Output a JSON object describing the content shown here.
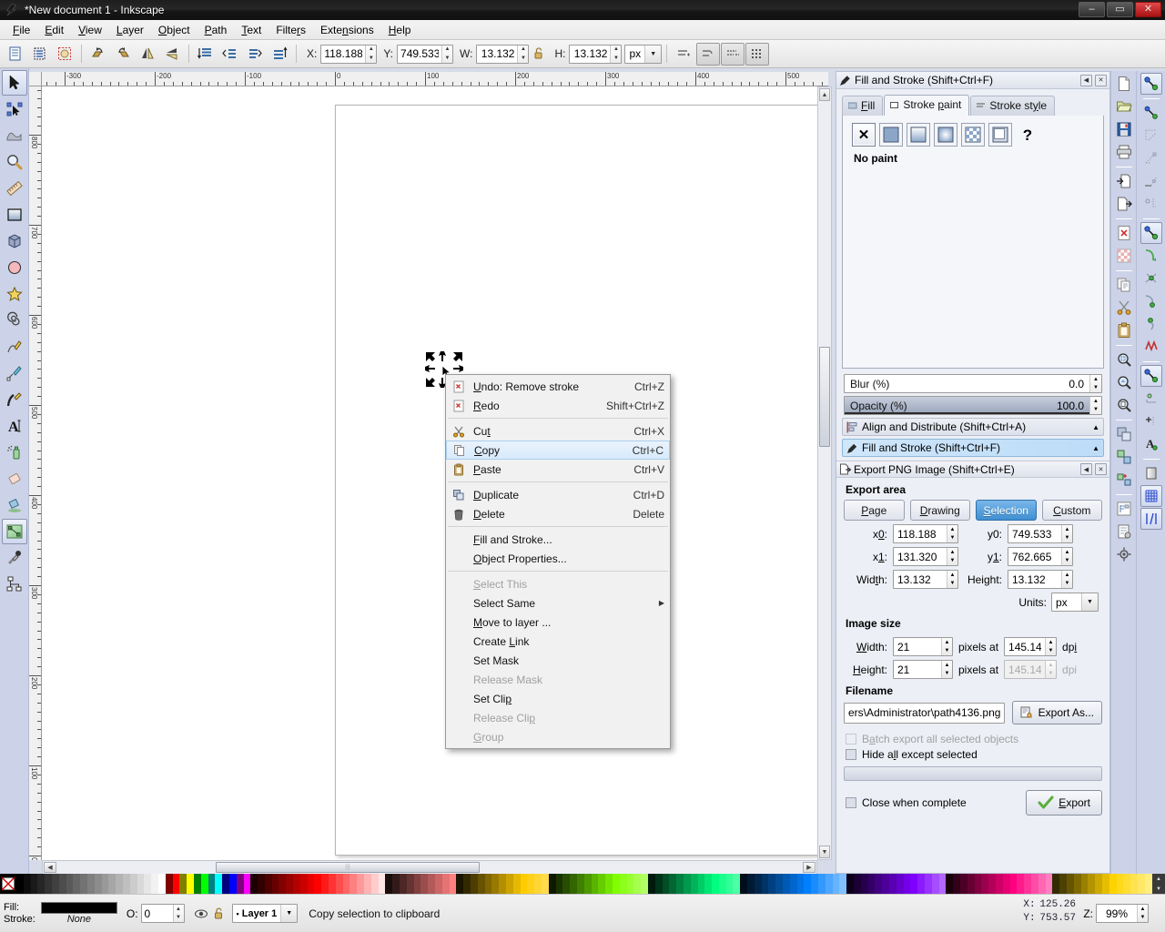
{
  "window": {
    "title": "*New document 1 - Inkscape",
    "minimize": "–",
    "maximize": "▭",
    "close": "✕"
  },
  "menubar": [
    {
      "label": "File",
      "mnemonic": "F"
    },
    {
      "label": "Edit",
      "mnemonic": "E"
    },
    {
      "label": "View",
      "mnemonic": "V"
    },
    {
      "label": "Layer",
      "mnemonic": "L"
    },
    {
      "label": "Object",
      "mnemonic": "O"
    },
    {
      "label": "Path",
      "mnemonic": "P"
    },
    {
      "label": "Text",
      "mnemonic": "T"
    },
    {
      "label": "Filters",
      "mnemonic": "r"
    },
    {
      "label": "Extensions",
      "mnemonic": "n"
    },
    {
      "label": "Help",
      "mnemonic": "H"
    }
  ],
  "toolbar": {
    "x_label": "X:",
    "x_value": "118.188",
    "y_label": "Y:",
    "y_value": "749.533",
    "w_label": "W:",
    "w_value": "13.132",
    "h_label": "H:",
    "h_value": "13.132",
    "units_value": "px",
    "lock_icon": "lock-open-icon",
    "icons": [
      "select-all-icon",
      "select-all-layers-icon",
      "deselect-icon",
      "rotate-90-ccw-icon",
      "rotate-90-cw-icon",
      "flip-horizontal-icon",
      "flip-vertical-icon",
      "raise-to-top-icon",
      "raise-icon",
      "lower-icon",
      "lower-to-bottom-icon"
    ],
    "transform_icons": [
      "affect-stroke-width-icon",
      "affect-rounded-corners-icon",
      "affect-gradients-icon",
      "affect-patterns-icon"
    ]
  },
  "toolbox": [
    {
      "name": "selector-tool",
      "selected": true
    },
    {
      "name": "node-tool",
      "selected": false
    },
    {
      "name": "tweak-tool",
      "selected": false
    },
    {
      "name": "zoom-tool",
      "selected": false
    },
    {
      "name": "measure-tool",
      "selected": false
    },
    {
      "name": "rectangle-tool",
      "selected": false
    },
    {
      "name": "3dbox-tool",
      "selected": false
    },
    {
      "name": "ellipse-tool",
      "selected": false
    },
    {
      "name": "star-tool",
      "selected": false
    },
    {
      "name": "spiral-tool",
      "selected": false
    },
    {
      "name": "pencil-tool",
      "selected": false
    },
    {
      "name": "bezier-tool",
      "selected": false
    },
    {
      "name": "calligraphy-tool",
      "selected": false
    },
    {
      "name": "text-tool",
      "selected": false
    },
    {
      "name": "spray-tool",
      "selected": false
    },
    {
      "name": "eraser-tool",
      "selected": false
    },
    {
      "name": "paintbucket-tool",
      "selected": false
    },
    {
      "name": "gradient-tool",
      "selected": true
    },
    {
      "name": "dropper-tool",
      "selected": false
    },
    {
      "name": "connector-tool",
      "selected": false
    }
  ],
  "rulers": {
    "horizontal_labels": [
      "-300",
      "-200",
      "-100",
      "0",
      "100",
      "200",
      "300",
      "400",
      "500"
    ],
    "vertical_labels": [
      "700",
      "600",
      "500",
      "400",
      "300",
      "200",
      "100",
      "0"
    ]
  },
  "context_menu": {
    "items": [
      {
        "label": "Undo: Remove stroke",
        "accel": "Ctrl+Z",
        "icon": "undo-icon",
        "state": "normal"
      },
      {
        "label": "Redo",
        "accel": "Shift+Ctrl+Z",
        "icon": "redo-icon",
        "state": "normal"
      },
      {
        "separator": true
      },
      {
        "label": "Cut",
        "accel": "Ctrl+X",
        "icon": "scissors-icon",
        "state": "normal"
      },
      {
        "label": "Copy",
        "accel": "Ctrl+C",
        "icon": "copy-icon",
        "state": "highlighted"
      },
      {
        "label": "Paste",
        "accel": "Ctrl+V",
        "icon": "clipboard-icon",
        "state": "normal"
      },
      {
        "separator": true
      },
      {
        "label": "Duplicate",
        "accel": "Ctrl+D",
        "icon": "duplicate-icon",
        "state": "normal"
      },
      {
        "label": "Delete",
        "accel": "Delete",
        "icon": "trash-icon",
        "state": "normal"
      },
      {
        "separator": true
      },
      {
        "label": "Fill and Stroke...",
        "accel": "",
        "icon": "",
        "state": "normal"
      },
      {
        "label": "Object Properties...",
        "accel": "",
        "icon": "",
        "state": "normal"
      },
      {
        "separator": true
      },
      {
        "label": "Select This",
        "accel": "",
        "icon": "",
        "state": "disabled"
      },
      {
        "label": "Select Same",
        "accel": "",
        "icon": "",
        "state": "submenu"
      },
      {
        "label": "Move to layer ...",
        "accel": "",
        "icon": "",
        "state": "normal"
      },
      {
        "label": "Create Link",
        "accel": "",
        "icon": "",
        "state": "normal"
      },
      {
        "label": "Set Mask",
        "accel": "",
        "icon": "",
        "state": "normal"
      },
      {
        "label": "Release Mask",
        "accel": "",
        "icon": "",
        "state": "disabled"
      },
      {
        "label": "Set Clip",
        "accel": "",
        "icon": "",
        "state": "normal"
      },
      {
        "label": "Release Clip",
        "accel": "",
        "icon": "",
        "state": "disabled"
      },
      {
        "label": "Group",
        "accel": "",
        "icon": "",
        "state": "disabled"
      }
    ]
  },
  "fill_stroke_panel": {
    "title": "Fill and Stroke (Shift+Ctrl+F)",
    "tabs": [
      {
        "label": "Fill",
        "active": false,
        "icon": "fill-swatch-icon"
      },
      {
        "label": "Stroke paint",
        "active": true,
        "icon": "stroke-swatch-icon"
      },
      {
        "label": "Stroke style",
        "active": false,
        "icon": "stroke-style-icon"
      }
    ],
    "paint_buttons": [
      {
        "name": "no-paint-button",
        "label": "✕",
        "active": true
      },
      {
        "name": "flat-color-button",
        "label": "",
        "active": false
      },
      {
        "name": "linear-gradient-button",
        "label": "",
        "active": false
      },
      {
        "name": "radial-gradient-button",
        "label": "",
        "active": false
      },
      {
        "name": "pattern-button",
        "label": "",
        "active": false
      },
      {
        "name": "swatch-button",
        "label": "",
        "active": false
      },
      {
        "name": "unknown-paint-button",
        "label": "?",
        "active": false
      }
    ],
    "paint_status": "No paint",
    "blur_label": "Blur (%)",
    "blur_value": "0.0",
    "opacity_label": "Opacity (%)",
    "opacity_value": "100.0"
  },
  "dock_bars": [
    {
      "label": "Align and Distribute (Shift+Ctrl+A)",
      "icon": "align-icon",
      "highlighted": false
    },
    {
      "label": "Fill and Stroke (Shift+Ctrl+F)",
      "icon": "fill-stroke-icon",
      "highlighted": true
    }
  ],
  "export_panel": {
    "title": "Export PNG Image (Shift+Ctrl+E)",
    "export_area_heading": "Export area",
    "area_buttons": [
      {
        "label": "Page",
        "mnemonic": "P",
        "selected": false
      },
      {
        "label": "Drawing",
        "mnemonic": "D",
        "selected": false
      },
      {
        "label": "Selection",
        "mnemonic": "S",
        "selected": true
      },
      {
        "label": "Custom",
        "mnemonic": "C",
        "selected": false
      }
    ],
    "fields": {
      "x0_label": "x0:",
      "x0_value": "118.188",
      "y0_label": "y0:",
      "y0_value": "749.533",
      "x1_label": "x1:",
      "x1_value": "131.320",
      "y1_label": "y1:",
      "y1_value": "762.665",
      "width_label": "Width:",
      "width_value": "13.132",
      "height_label": "Height:",
      "height_value": "13.132",
      "units_label": "Units:",
      "units_value": "px"
    },
    "image_size_heading": "Image size",
    "image_size": {
      "width_label": "Width:",
      "width_value": "21",
      "pixels_at_1": "pixels at",
      "dpi_1_value": "145.14",
      "dpi_1_label": "dpi",
      "height_label": "Height:",
      "height_value": "21",
      "pixels_at_2": "pixels at",
      "dpi_2_value": "145.14",
      "dpi_2_label": "dpi"
    },
    "filename_heading": "Filename",
    "filename_value": "ers\\Administrator\\path4136.png",
    "export_as_label": "Export As...",
    "batch_label": "Batch export all selected objects",
    "hide_label": "Hide all except selected",
    "close_label": "Close when complete",
    "export_button": "Export"
  },
  "statusbar": {
    "fill_label": "Fill:",
    "stroke_label": "Stroke:",
    "fill_color": "#000000",
    "stroke_value": "None",
    "opacity_label": "O:",
    "opacity_value": "0",
    "layer_name": "Layer 1",
    "message": "Copy selection to clipboard",
    "x_label": "X:",
    "x_value": "125.26",
    "y_label": "Y:",
    "y_value": "753.57",
    "z_label": "Z:",
    "zoom_value": "99%"
  },
  "palette": {
    "none_swatch": "none-color-swatch",
    "colors": [
      "#000000",
      "#0d0d0d",
      "#1a1a1a",
      "#262626",
      "#333333",
      "#404040",
      "#4d4d4d",
      "#595959",
      "#666666",
      "#737373",
      "#808080",
      "#8c8c8c",
      "#999999",
      "#a6a6a6",
      "#b3b3b3",
      "#bfbfbf",
      "#cccccc",
      "#d9d9d9",
      "#e6e6e6",
      "#f2f2f2",
      "#ffffff",
      "#800000",
      "#ff0000",
      "#808000",
      "#ffff00",
      "#008000",
      "#00ff00",
      "#008080",
      "#00ffff",
      "#000080",
      "#0000ff",
      "#800080",
      "#ff00ff",
      "#1a0000",
      "#330000",
      "#4d0000",
      "#660000",
      "#800000",
      "#990000",
      "#b30000",
      "#cc0000",
      "#e60000",
      "#ff0000",
      "#ff1a1a",
      "#ff3333",
      "#ff4d4d",
      "#ff6666",
      "#ff8080",
      "#ff9999",
      "#ffb3b3",
      "#ffcccc",
      "#ffe6e6",
      "#1a0d0d",
      "#331a1a",
      "#4d2626",
      "#663333",
      "#804040",
      "#994d4d",
      "#b35959",
      "#cc6666",
      "#e67373",
      "#ff8080",
      "#1a1400",
      "#332900",
      "#4d3d00",
      "#665200",
      "#806600",
      "#997a00",
      "#b38f00",
      "#cca300",
      "#e6b800",
      "#ffcc00",
      "#ffd11a",
      "#ffd633",
      "#ffdb4d",
      "#0d1a00",
      "#1a3300",
      "#264d00",
      "#336600",
      "#408000",
      "#4d9900",
      "#59b300",
      "#66cc00",
      "#73e600",
      "#80ff00",
      "#8cff1a",
      "#99ff33",
      "#a6ff4d",
      "#b3ff66",
      "#001a0d",
      "#00331a",
      "#004d26",
      "#006633",
      "#008040",
      "#00994d",
      "#00b359",
      "#00cc66",
      "#00e673",
      "#00ff80",
      "#1aff8c",
      "#33ff99",
      "#4dffa6",
      "#000d1a",
      "#001a33",
      "#00264d",
      "#003366",
      "#004080",
      "#004d99",
      "#0059b3",
      "#0066cc",
      "#0073e6",
      "#0080ff",
      "#1a8cff",
      "#3399ff",
      "#4da6ff",
      "#66b3ff",
      "#80c0ff",
      "#0d001a",
      "#1a0033",
      "#26004d",
      "#330066",
      "#400080",
      "#4d0099",
      "#5900b3",
      "#6600cc",
      "#7300e6",
      "#8000ff",
      "#8c1aff",
      "#9933ff",
      "#a64dff",
      "#b366ff",
      "#1a000d",
      "#33001a",
      "#4d0026",
      "#660033",
      "#800040",
      "#99004d",
      "#b30059",
      "#cc0066",
      "#e60073",
      "#ff0080",
      "#ff1a8c",
      "#ff3399",
      "#ff4da6",
      "#ff66b3",
      "#ff80c0",
      "#332b00",
      "#4d4000",
      "#665500",
      "#806a00",
      "#998000",
      "#b39400",
      "#cca900",
      "#e6be00",
      "#ffd300",
      "#ffd91a",
      "#ffde33",
      "#ffe34d",
      "#ffe866",
      "#ffee80"
    ]
  }
}
